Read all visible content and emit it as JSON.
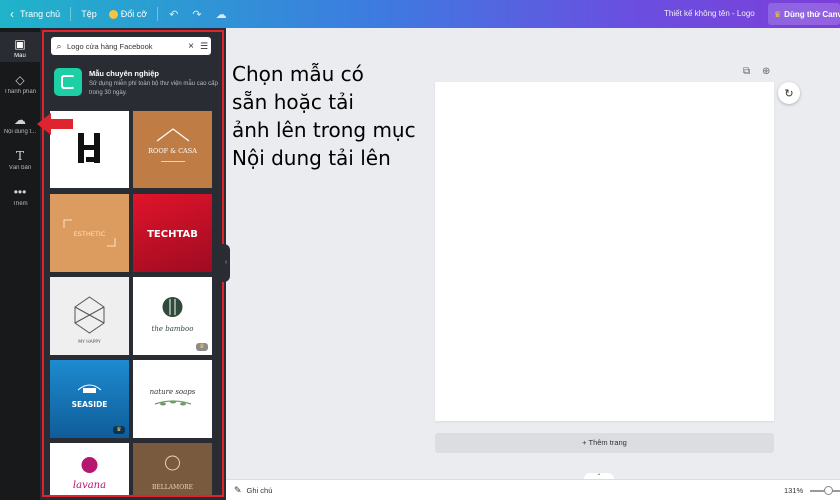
{
  "topbar": {
    "home_label": "Trang chủ",
    "file_label": "Tệp",
    "resize_label": "Đổi cỡ",
    "design_title": "Thiết kế không tên - Logo",
    "trial_label": "Dùng thử Canva"
  },
  "rail": {
    "items": [
      {
        "label": "Mẫu",
        "icon": "template-icon"
      },
      {
        "label": "Thành phần",
        "icon": "elements-icon"
      },
      {
        "label": "Nội dung t...",
        "icon": "upload-cloud-icon"
      },
      {
        "label": "Văn bản",
        "icon": "text-icon"
      },
      {
        "label": "Thêm",
        "icon": "more-icon"
      }
    ]
  },
  "panel": {
    "search_value": "Logo cửa hàng Facebook",
    "promo_title": "Mẫu chuyên nghiệp",
    "promo_text": "Sử dụng miễn phí toàn bộ thư viện mẫu cao cấp trong 30 ngày.",
    "templates": [
      {
        "text": "",
        "bg": "#ffffff"
      },
      {
        "text": "ROOF & CASA",
        "bg": "#bf7d45"
      },
      {
        "text": "ESTHETIC",
        "bg": "#dc9b5f"
      },
      {
        "text": "TECHTAB",
        "bg": "#c8102e"
      },
      {
        "text": "MY HAPPY",
        "bg": "#efefef"
      },
      {
        "text": "the bamboo",
        "bg": "#ffffff"
      },
      {
        "text": "SEASIDE",
        "bg": "#1675b0"
      },
      {
        "text": "nature soaps",
        "bg": "#ffffff"
      },
      {
        "text": "lavana",
        "bg": "#ffffff"
      },
      {
        "text": "BELLAMORE",
        "bg": "#7a5a3e"
      }
    ]
  },
  "canvas": {
    "add_page_label": "+ Thêm trang"
  },
  "bottombar": {
    "notes_label": "Ghi chú",
    "zoom_label": "131%"
  },
  "annotation": {
    "lines": [
      "Chọn mẫu có",
      "sẵn hoặc tải",
      "ảnh lên trong mục",
      "Nội dung tải lên"
    ],
    "arrow_color": "#e0242f"
  }
}
